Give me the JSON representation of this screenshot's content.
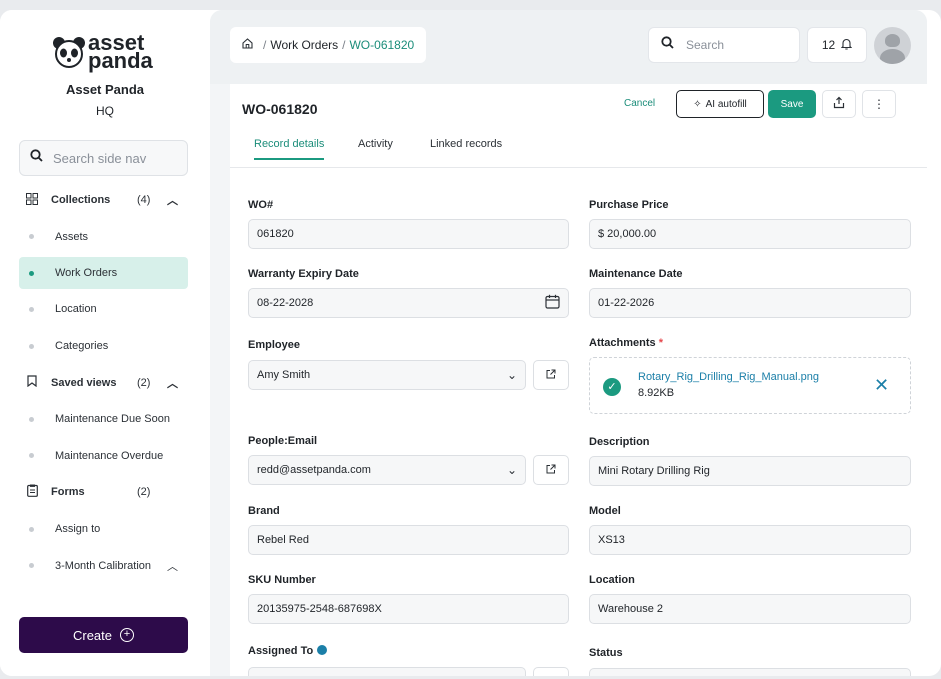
{
  "brand": {
    "logo_line1": "asset",
    "logo_line2": "panda",
    "name": "Asset Panda",
    "sub": "HQ"
  },
  "sidebar": {
    "search_placeholder": "Search side nav",
    "groups": [
      {
        "label": "Collections",
        "count": "(4)",
        "icon": "grid-icon"
      },
      {
        "label": "Saved views",
        "count": "(2)",
        "icon": "bookmark-icon"
      },
      {
        "label": "Forms",
        "count": "(2)",
        "icon": "clipboard-icon"
      }
    ],
    "items": [
      "Assets",
      "Work Orders",
      "Location",
      "Categories",
      "Maintenance Due Soon",
      "Maintenance Overdue",
      "Assign to",
      "3-Month Calibration"
    ],
    "create_label": "Create"
  },
  "topbar": {
    "breadcrumb": [
      "Work Orders",
      "WO-061820"
    ],
    "search_placeholder": "Search",
    "notifications": "12"
  },
  "record": {
    "title": "WO-061820",
    "cancel": "Cancel",
    "ai_autofill": "AI autofill",
    "save": "Save",
    "tabs": [
      "Record details",
      "Activity",
      "Linked records"
    ]
  },
  "fields": {
    "wo_label": "WO#",
    "wo_value": "061820",
    "purchase_label": "Purchase Price",
    "purchase_value": "$ 20,000.00",
    "warranty_label": "Warranty Expiry Date",
    "warranty_value": "08-22-2028",
    "maint_label": "Maintenance Date",
    "maint_value": "01-22-2026",
    "employee_label": "Employee",
    "employee_value": "Amy Smith",
    "attachments_label": "Attachments",
    "attachments_required": "*",
    "attachment_name": "Rotary_Rig_Drilling_Rig_Manual.png",
    "attachment_size": "8.92KB",
    "email_label": "People:Email",
    "email_value": "redd@assetpanda.com",
    "description_label": "Description",
    "description_value": "Mini Rotary Drilling Rig",
    "brand_label": "Brand",
    "brand_value": "Rebel Red",
    "model_label": "Model",
    "model_value": "XS13",
    "sku_label": "SKU Number",
    "sku_value": "20135975-2548-687698X",
    "location_label": "Location",
    "location_value": "Warehouse 2",
    "assigned_label": "Assigned To",
    "status_label": "Status"
  }
}
